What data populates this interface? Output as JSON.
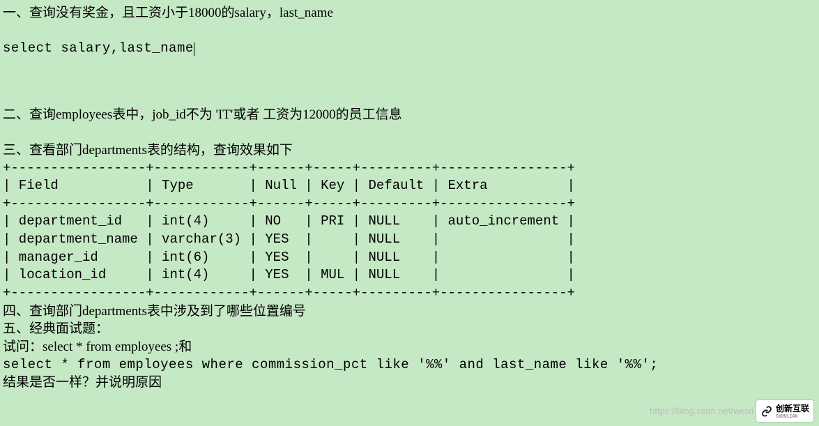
{
  "q1": {
    "title": "一、查询没有奖金，且工资小于18000的salary，last_name",
    "sql": "select salary,last_name"
  },
  "q2": {
    "title": "二、查询employees表中，job_id不为 'IT'或者 工资为12000的员工信息"
  },
  "q3": {
    "title": "三、查看部门departments表的结构，查询效果如下"
  },
  "table": {
    "divider_top": "+-----------------+------------+------+-----+---------+----------------+",
    "header": "| Field           | Type       | Null | Key | Default | Extra          |",
    "divider_mid": "+-----------------+------------+------+-----+---------+----------------+",
    "row1": "| department_id   | int(4)     | NO   | PRI | NULL    | auto_increment |",
    "row2": "| department_name | varchar(3) | YES  |     | NULL    |                |",
    "row3": "| manager_id      | int(6)     | YES  |     | NULL    |                |",
    "row4": "| location_id     | int(4)     | YES  | MUL | NULL    |                |",
    "divider_bot": "+-----------------+------------+------+-----+---------+----------------+"
  },
  "q4": {
    "title": "四、查询部门departments表中涉及到了哪些位置编号"
  },
  "q5": {
    "title": "五、经典面试题：",
    "line1": "试问：select * from employees ;和",
    "line2": "select * from employees where commission_pct like '%%' and last_name like '%%';",
    "line3": "结果是否一样？并说明原因"
  },
  "watermark": {
    "url": "https://blog.csdn.net/weixi",
    "badge_main": "创新互联",
    "badge_sub": "CXHULIAN"
  },
  "chart_data": {
    "type": "table",
    "title": "departments表结构",
    "columns": [
      "Field",
      "Type",
      "Null",
      "Key",
      "Default",
      "Extra"
    ],
    "rows": [
      [
        "department_id",
        "int(4)",
        "NO",
        "PRI",
        "NULL",
        "auto_increment"
      ],
      [
        "department_name",
        "varchar(3)",
        "YES",
        "",
        "NULL",
        ""
      ],
      [
        "manager_id",
        "int(6)",
        "YES",
        "",
        "NULL",
        ""
      ],
      [
        "location_id",
        "int(4)",
        "YES",
        "MUL",
        "NULL",
        ""
      ]
    ]
  }
}
